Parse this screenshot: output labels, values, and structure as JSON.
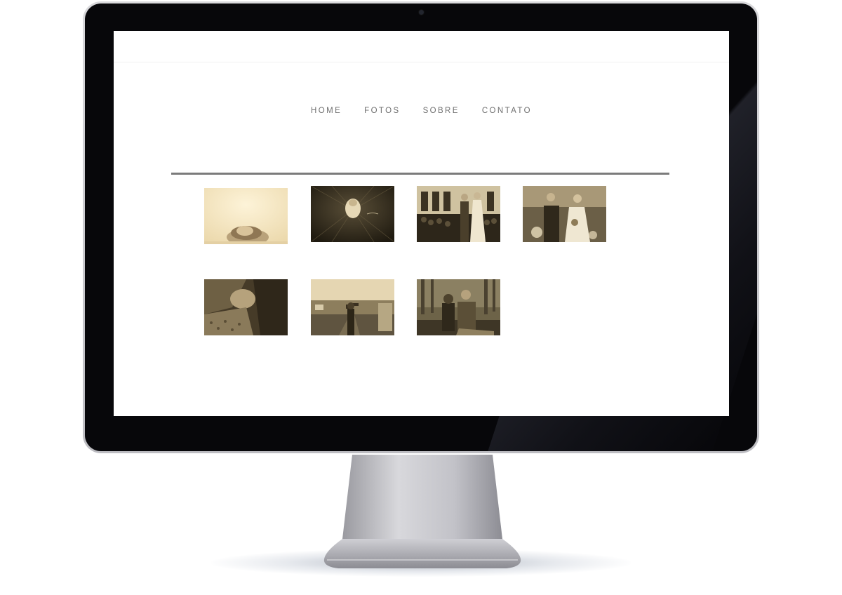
{
  "nav": {
    "items": [
      "HOME",
      "FOTOS",
      "SOBRE",
      "CONTATO"
    ]
  },
  "gallery": {
    "photos": [
      {
        "subject": "newborn baby in basket"
      },
      {
        "subject": "baby on dark blanket"
      },
      {
        "subject": "wedding couple at altar"
      },
      {
        "subject": "bride and groom portrait"
      },
      {
        "subject": "couple close-up embrace"
      },
      {
        "subject": "woman on city street"
      },
      {
        "subject": "couple sitting outdoors"
      }
    ]
  },
  "colors": {
    "bezel": "#07070a",
    "nav_text": "#6f6f6f",
    "divider": "#7b7b7b",
    "sepia_light": "#f4e7c7",
    "sepia_dark": "#2e271a"
  },
  "icons": {
    "camera": "webcam-dot"
  }
}
